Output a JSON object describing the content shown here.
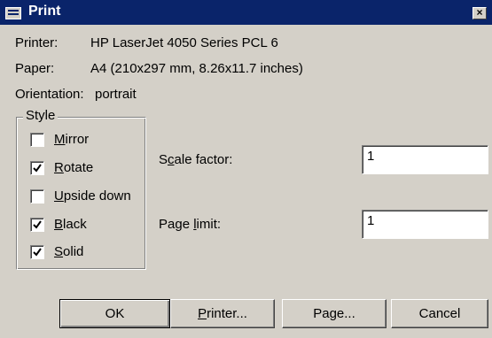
{
  "window": {
    "title": "Print",
    "close_glyph": "×"
  },
  "info": {
    "printer_label": "Printer:",
    "printer_value": "HP LaserJet 4050 Series PCL 6",
    "paper_label": "Paper:",
    "paper_value": "A4 (210x297 mm, 8.26x11.7 inches)",
    "orientation_label": "Orientation:",
    "orientation_value": "portrait"
  },
  "style_group": {
    "legend": "Style",
    "options": [
      {
        "label": "Mirror",
        "checked": false
      },
      {
        "label": "Rotate",
        "checked": true
      },
      {
        "label": "Upside down",
        "checked": false
      },
      {
        "label": "Black",
        "checked": true
      },
      {
        "label": "Solid",
        "checked": true
      }
    ]
  },
  "fields": {
    "scale_label": "Scale factor:",
    "scale_value": "1",
    "page_limit_label": "Page limit:",
    "page_limit_value": "1"
  },
  "buttons": {
    "ok": "OK",
    "printer": "Printer...",
    "page": "Page...",
    "cancel": "Cancel"
  }
}
